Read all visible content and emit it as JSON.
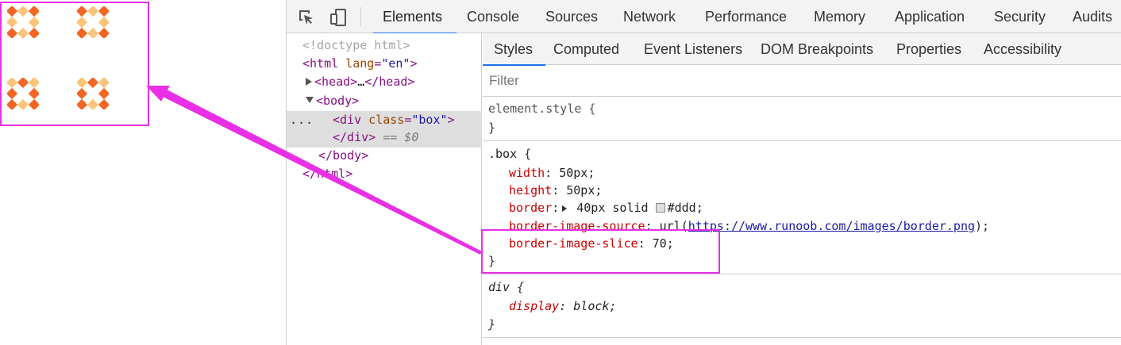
{
  "devtools": {
    "tabs": [
      "Elements",
      "Console",
      "Sources",
      "Network",
      "Performance",
      "Memory",
      "Application",
      "Security",
      "Audits"
    ],
    "active_tab": "Elements"
  },
  "dom_tree": {
    "doctype": "<!doctype html>",
    "html_open_tag": "html",
    "html_attr_name": "lang",
    "html_attr_value": "\"en\"",
    "head_tag": "head",
    "head_ellipsis": "…",
    "body_tag": "body",
    "div_tag": "div",
    "div_attr_name": "class",
    "div_attr_value": "\"box\"",
    "div_close_tag": "/div",
    "selected_marker": "== $0",
    "body_close_tag": "/body",
    "html_close_tag": "/html",
    "row_actions": "..."
  },
  "styles_pane": {
    "subtabs": [
      "Styles",
      "Computed",
      "Event Listeners",
      "DOM Breakpoints",
      "Properties",
      "Accessibility"
    ],
    "active_subtab": "Styles",
    "filter_placeholder": "Filter",
    "element_style": {
      "selector": "element.style {",
      "close": "}"
    },
    "box_rule": {
      "selector": ".box",
      "open": "{",
      "close": "}",
      "width_name": "width",
      "width_value": "50px",
      "height_name": "height",
      "height_value": "50px",
      "border_name": "border",
      "border_value": "40px solid",
      "border_color_value": "#ddd",
      "border_color": "#dddddd",
      "source_name": "border-image-source",
      "source_fn": "url(",
      "source_url": "https://www.runoob.com/images/border.png",
      "source_end": ");",
      "slice_name": "border-image-slice",
      "slice_value": "70"
    },
    "div_rule": {
      "selector": "div",
      "open": "{",
      "close": "}",
      "display_name": "display",
      "display_value": "block"
    }
  },
  "colors": {
    "highlight": "#e82fe6",
    "tab_underline": "#1a73e8",
    "diamond_dark": "#f26522",
    "diamond_light": "#fcc47a"
  },
  "icons": [
    "inspect-element-icon",
    "device-toolbar-icon"
  ]
}
